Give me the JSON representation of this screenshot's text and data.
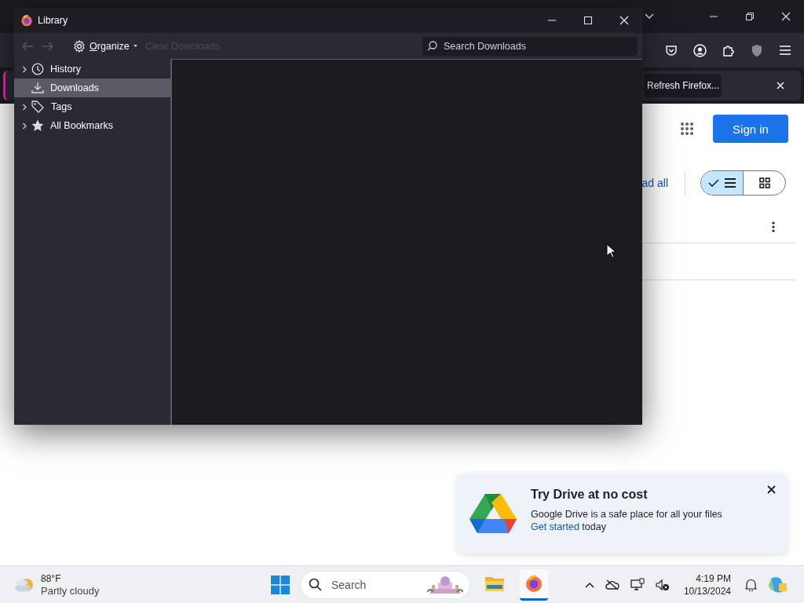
{
  "browser": {
    "notification": {
      "button": "Refresh Firefox..."
    },
    "content": {
      "sign_in": "Sign in",
      "partial_link": "ad all",
      "view_toggle": [
        {
          "kind": "list",
          "selected": true
        },
        {
          "kind": "grid",
          "selected": false
        }
      ]
    },
    "promo": {
      "title": "Try Drive at no cost",
      "text": "Google Drive is a safe place for all your files",
      "link": "Get started",
      "after_link": "today"
    }
  },
  "library": {
    "title": "Library",
    "organize": "Organize",
    "clear_downloads": {
      "label": "Clear Downloads",
      "disabled": true
    },
    "search": {
      "placeholder": "Search Downloads"
    },
    "sidebar": [
      {
        "label": "History",
        "kind": "history",
        "expandable": true,
        "selected": false
      },
      {
        "label": "Downloads",
        "kind": "downloads",
        "expandable": false,
        "selected": true
      },
      {
        "label": "Tags",
        "kind": "tags",
        "expandable": true,
        "selected": false
      },
      {
        "label": "All Bookmarks",
        "kind": "bookmarks",
        "expandable": true,
        "selected": false
      }
    ]
  },
  "taskbar": {
    "weather": {
      "temperature": "88°F",
      "condition": "Partly cloudy"
    },
    "search": {
      "placeholder": "Search"
    },
    "apps": [
      {
        "kind": "files",
        "selected": false
      },
      {
        "kind": "firefox",
        "selected": true
      }
    ],
    "clock": {
      "time": "4:19 PM",
      "date": "10/13/2024"
    }
  }
}
